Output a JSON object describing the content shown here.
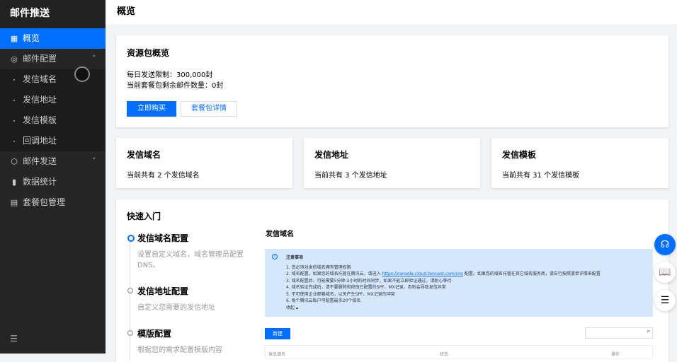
{
  "sidebar": {
    "title": "邮件推送",
    "items": [
      {
        "label": "概览",
        "icon": "grid-icon"
      },
      {
        "label": "邮件配置",
        "icon": "config-icon",
        "sub": [
          "发信域名",
          "发信地址",
          "发信模板",
          "回调地址"
        ]
      },
      {
        "label": "邮件发送",
        "icon": "send-icon"
      },
      {
        "label": "数据统计",
        "icon": "chart-icon"
      },
      {
        "label": "套餐包管理",
        "icon": "package-icon"
      }
    ]
  },
  "header": {
    "title": "概览"
  },
  "resource": {
    "title": "资源包概览",
    "daily_limit": "每日发送限制：300,000封",
    "remaining": "当前套餐包剩余邮件数量：0封",
    "buy": "立即购买",
    "details": "套餐包详情"
  },
  "summary": [
    {
      "title": "发信域名",
      "text": "当前共有 2 个发信域名"
    },
    {
      "title": "发信地址",
      "text": "当前共有 3 个发信地址"
    },
    {
      "title": "发信模板",
      "text": "当前共有 31 个发信模板"
    }
  ],
  "quick": {
    "title": "快速入门",
    "steps": [
      {
        "title": "发信域名配置",
        "desc": "设置自定义域名，域名管理员配置DNS。"
      },
      {
        "title": "发信地址配置",
        "desc": "自定义您需要的发信地址"
      },
      {
        "title": "模版配置",
        "desc": "根据您的需求配置模版内容"
      }
    ],
    "panel_title": "发信域名",
    "notice": {
      "title": "注意事项",
      "items": [
        "1. 您必须对发信域名拥有管理权限",
        "2. 域名配置。如果您的域名托管在腾讯云，请进入 ",
        "3. 域名配置后，可能需要5分钟-2小时的时间同步，如果不能立即验证通过，请耐心等待",
        "4. 域名验证完成后，请不要删除和修改已配置的SPF、MX记录，否则会导致发信异常",
        "5. 不可使用企业邮箱域名，以免产生SPF、MX记录的冲突",
        "6. 每个腾讯云账户可配置最多20个域名"
      ],
      "link": "https://console.cloud.tencent.com/cns",
      "link_tail": " 配置。如果您的域名托管在其它域名服务商，请自行按照清单详情来配置",
      "collapse": "收起"
    },
    "new_btn": "新建",
    "columns": [
      "发信域名",
      "状态",
      "操作"
    ]
  }
}
